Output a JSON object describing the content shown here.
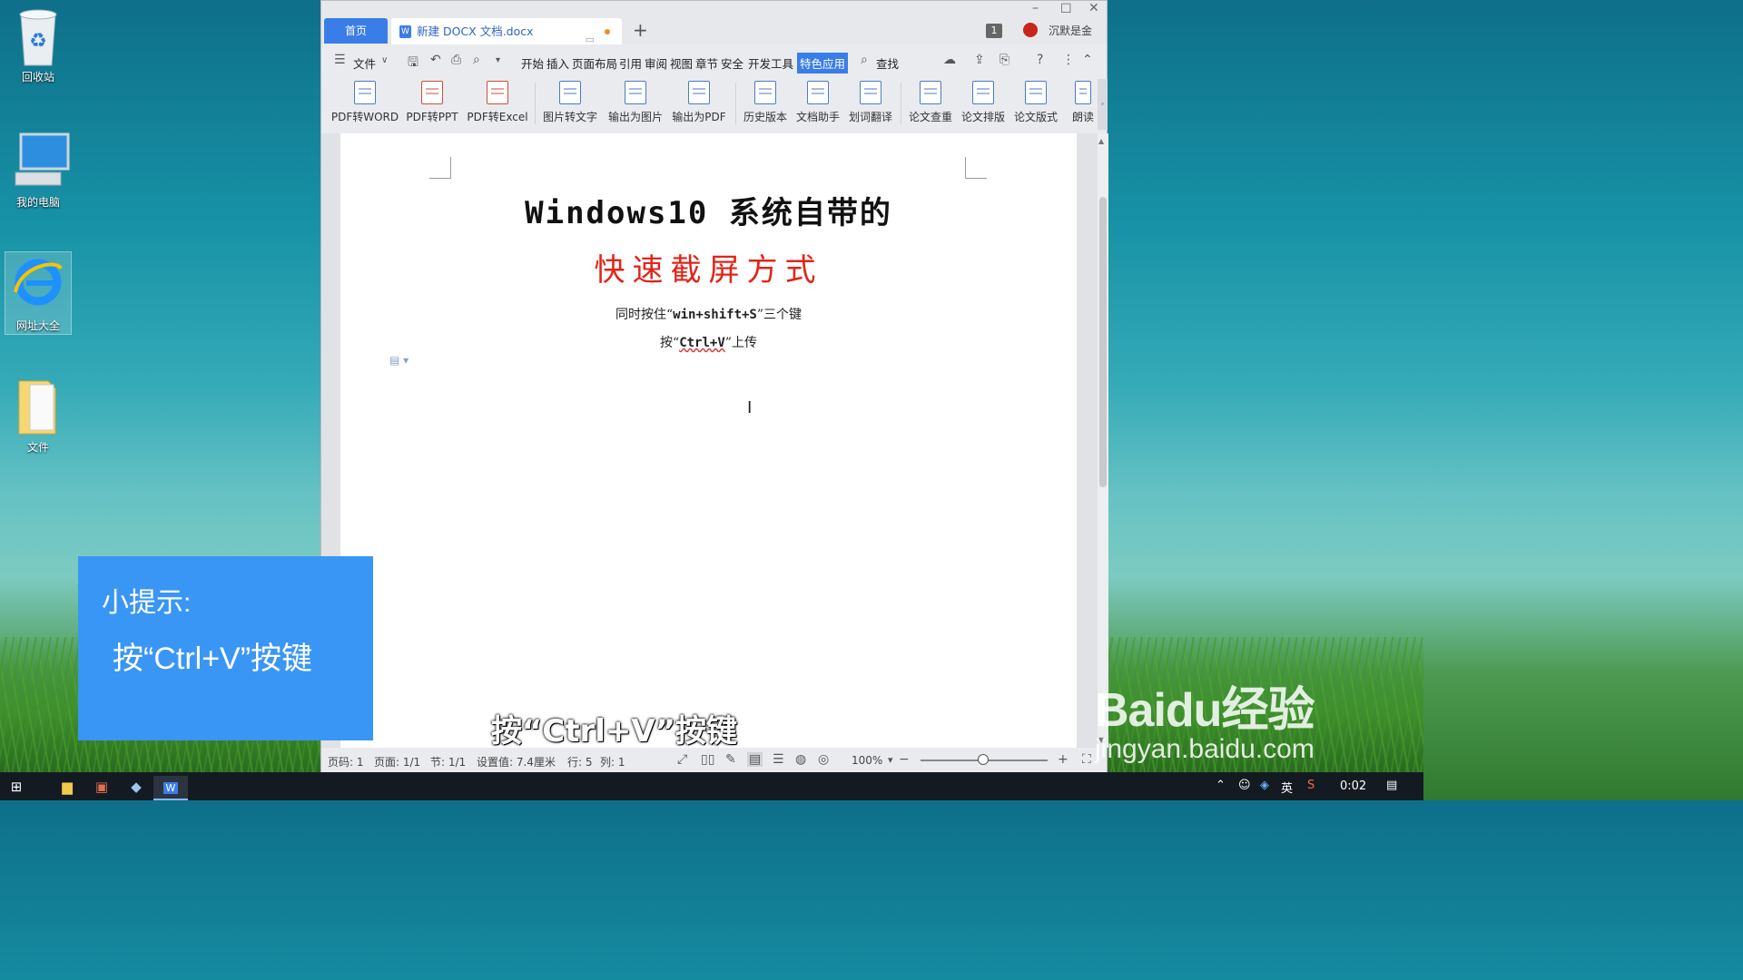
{
  "desktop": {
    "icons": [
      {
        "label": "回收站",
        "icon": "recycle-bin-icon"
      },
      {
        "label": "我的电脑",
        "icon": "computer-icon"
      },
      {
        "label": "网址大全",
        "icon": "ie-browser-icon"
      },
      {
        "label": "文件",
        "icon": "folder-icon"
      }
    ]
  },
  "window": {
    "tabs": {
      "home": "首页",
      "doc": "新建 DOCX 文档.docx",
      "doc_icon_text": "W"
    },
    "badge": "1",
    "user": "沉默是金",
    "menu": {
      "file": "文件",
      "items": [
        "开始",
        "插入",
        "页面布局",
        "引用",
        "审阅",
        "视图",
        "章节",
        "安全",
        "开发工具"
      ],
      "highlighted": "特色应用",
      "search": "查找"
    },
    "ribbon": [
      "PDF转WORD",
      "PDF转PPT",
      "PDF转Excel",
      "图片转文字",
      "输出为图片",
      "输出为PDF",
      "历史版本",
      "文档助手",
      "划词翻译",
      "论文查重",
      "论文排版",
      "论文版式",
      "朗读"
    ],
    "document": {
      "title": "Windows10 系统自带的",
      "subtitle": "快速截屏方式",
      "line1_pre": "同时按住“",
      "line1_bold": "win+shift+S",
      "line1_post": "”三个键",
      "line2_pre": "按“",
      "line2_bold": "Ctrl+V",
      "line2_post": "”上传"
    },
    "status": {
      "page_num": "页码: 1",
      "pages": "页面: 1/1",
      "section": "节: 1/1",
      "setting": "设置值: 7.4厘米",
      "row": "行: 5",
      "col": "列: 1",
      "zoom": "100%"
    }
  },
  "tip": {
    "title": "小提示:",
    "body": "按“Ctrl+V”按键"
  },
  "caption": "按“Ctrl+V”按键",
  "watermark": {
    "brand": "Baidu经验",
    "url": "jingyan.baidu.com"
  },
  "taskbar": {
    "tray_lang": "英",
    "clock": "0:02"
  },
  "colors": {
    "accent": "#3b7de8",
    "tip_bg": "#3a96f5",
    "subtitle_red": "#e02518"
  }
}
